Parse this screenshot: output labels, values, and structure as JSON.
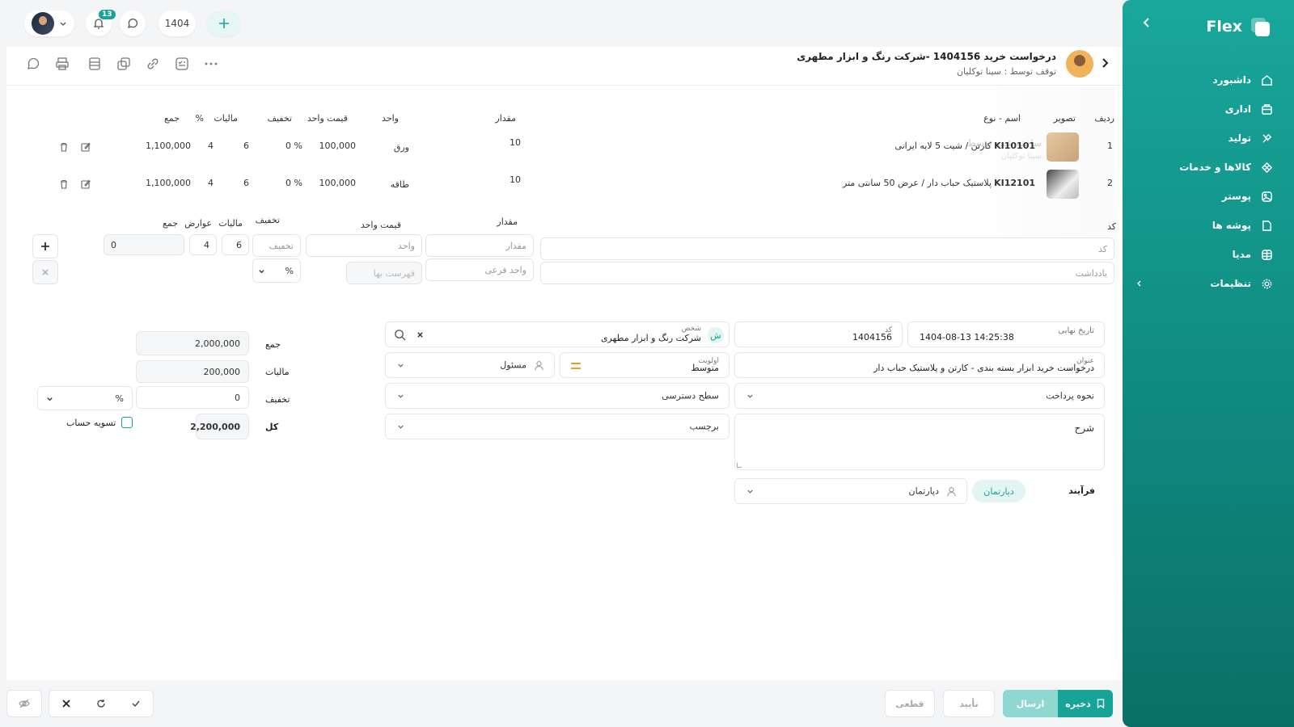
{
  "app": {
    "logo_text": "Flex",
    "brand_color": "#17a497"
  },
  "sidebar": {
    "items": [
      {
        "label": "داشبورد",
        "icon": "home-icon"
      },
      {
        "label": "اداری",
        "icon": "briefcase-icon"
      },
      {
        "label": "تولید",
        "icon": "tools-icon"
      },
      {
        "label": "کالاها و خدمات",
        "icon": "box-icon"
      },
      {
        "label": "پوستر",
        "icon": "image-icon"
      },
      {
        "label": "پوشه ها",
        "icon": "folder-icon"
      },
      {
        "label": "مدیا",
        "icon": "media-icon"
      },
      {
        "label": "تنظیمات",
        "icon": "gear-icon"
      }
    ]
  },
  "topbar": {
    "notifications_count": "13",
    "year": "1404"
  },
  "header": {
    "title": "درخواست خرید 1404156 -شرکت رنگ و ابزار مطهری",
    "subtitle": "توقف توسط : سینا توکلیان"
  },
  "ghost_card": {
    "line1": "ساخته شده توسط",
    "line2": "سینا توکلیان"
  },
  "items_table": {
    "headers": {
      "row": "ردیف",
      "image": "تصویر",
      "name": "اسم - نوع",
      "qty": "مقدار",
      "unit": "واحد",
      "unit_price": "قیمت واحد",
      "discount": "تخفیف",
      "tax": "مالیات",
      "percent": "%",
      "total": "جمع"
    },
    "rows": [
      {
        "idx": "1",
        "code": "KI10101",
        "name": "کارتن / شیت 5 لایه ایرانی",
        "qty": "10",
        "unit": "ورق",
        "price": "100,000",
        "discount": "0 %",
        "tax": "6",
        "pct": "4",
        "total": "1,100,000"
      },
      {
        "idx": "2",
        "code": "KI12101",
        "name": "پلاستیک حباب دار / عرض 50 سانتی متر",
        "qty": "10",
        "unit": "طاقه",
        "price": "100,000",
        "discount": "0 %",
        "tax": "6",
        "pct": "4",
        "total": "1,100,000"
      }
    ]
  },
  "entry": {
    "labels": {
      "code": "کد",
      "qty": "مقدار",
      "unit_price": "قیمت واحد",
      "discount": "تخفیف",
      "tax": "مالیات",
      "fees": "عوارض",
      "total": "جمع"
    },
    "placeholders": {
      "code": "کد",
      "note": "یادداشت",
      "qty": "مقدار",
      "sub_unit": "واحد فرعی",
      "unit": "واحد",
      "price_list": "فهرست بها",
      "discount": "تخفیف"
    },
    "values": {
      "tax": "6",
      "fees": "4",
      "total": "0",
      "discount_type": "%"
    }
  },
  "form": {
    "final_date_label": "تاریخ نهایی",
    "final_date": "1404-08-13 14:25:38",
    "code_label": "کد",
    "code": "1404156",
    "person_label": "شخص",
    "person": "شرکت رنگ و ابزار مطهری",
    "person_initial": "ش",
    "title_label": "عنوان",
    "title": "درخواست خرید ابزار بسته بندی - کارتن و پلاستیک حباب دار",
    "priority_label": "اولویت",
    "priority": "متوسط",
    "responsible": "مسئول",
    "payment_method": "نحوه پرداخت",
    "access_level": "سطح دسترسی",
    "description": "شرح",
    "tag": "برچسب",
    "tab_process": "فرآیند",
    "tab_department": "دپارتمان",
    "department": "دپارتمان"
  },
  "totals": {
    "sum_label": "جمع",
    "sum": "2,000,000",
    "tax_label": "مالیات",
    "tax": "200,000",
    "discount_label": "تخفیف",
    "discount": "0",
    "discount_type": "%",
    "total_label": "کل",
    "total": "2,200,000",
    "settle_label": "تسویه حساب"
  },
  "footer": {
    "save": "ذخیره",
    "send": "ارسال",
    "confirm": "تأیید",
    "final": "قطعی"
  }
}
